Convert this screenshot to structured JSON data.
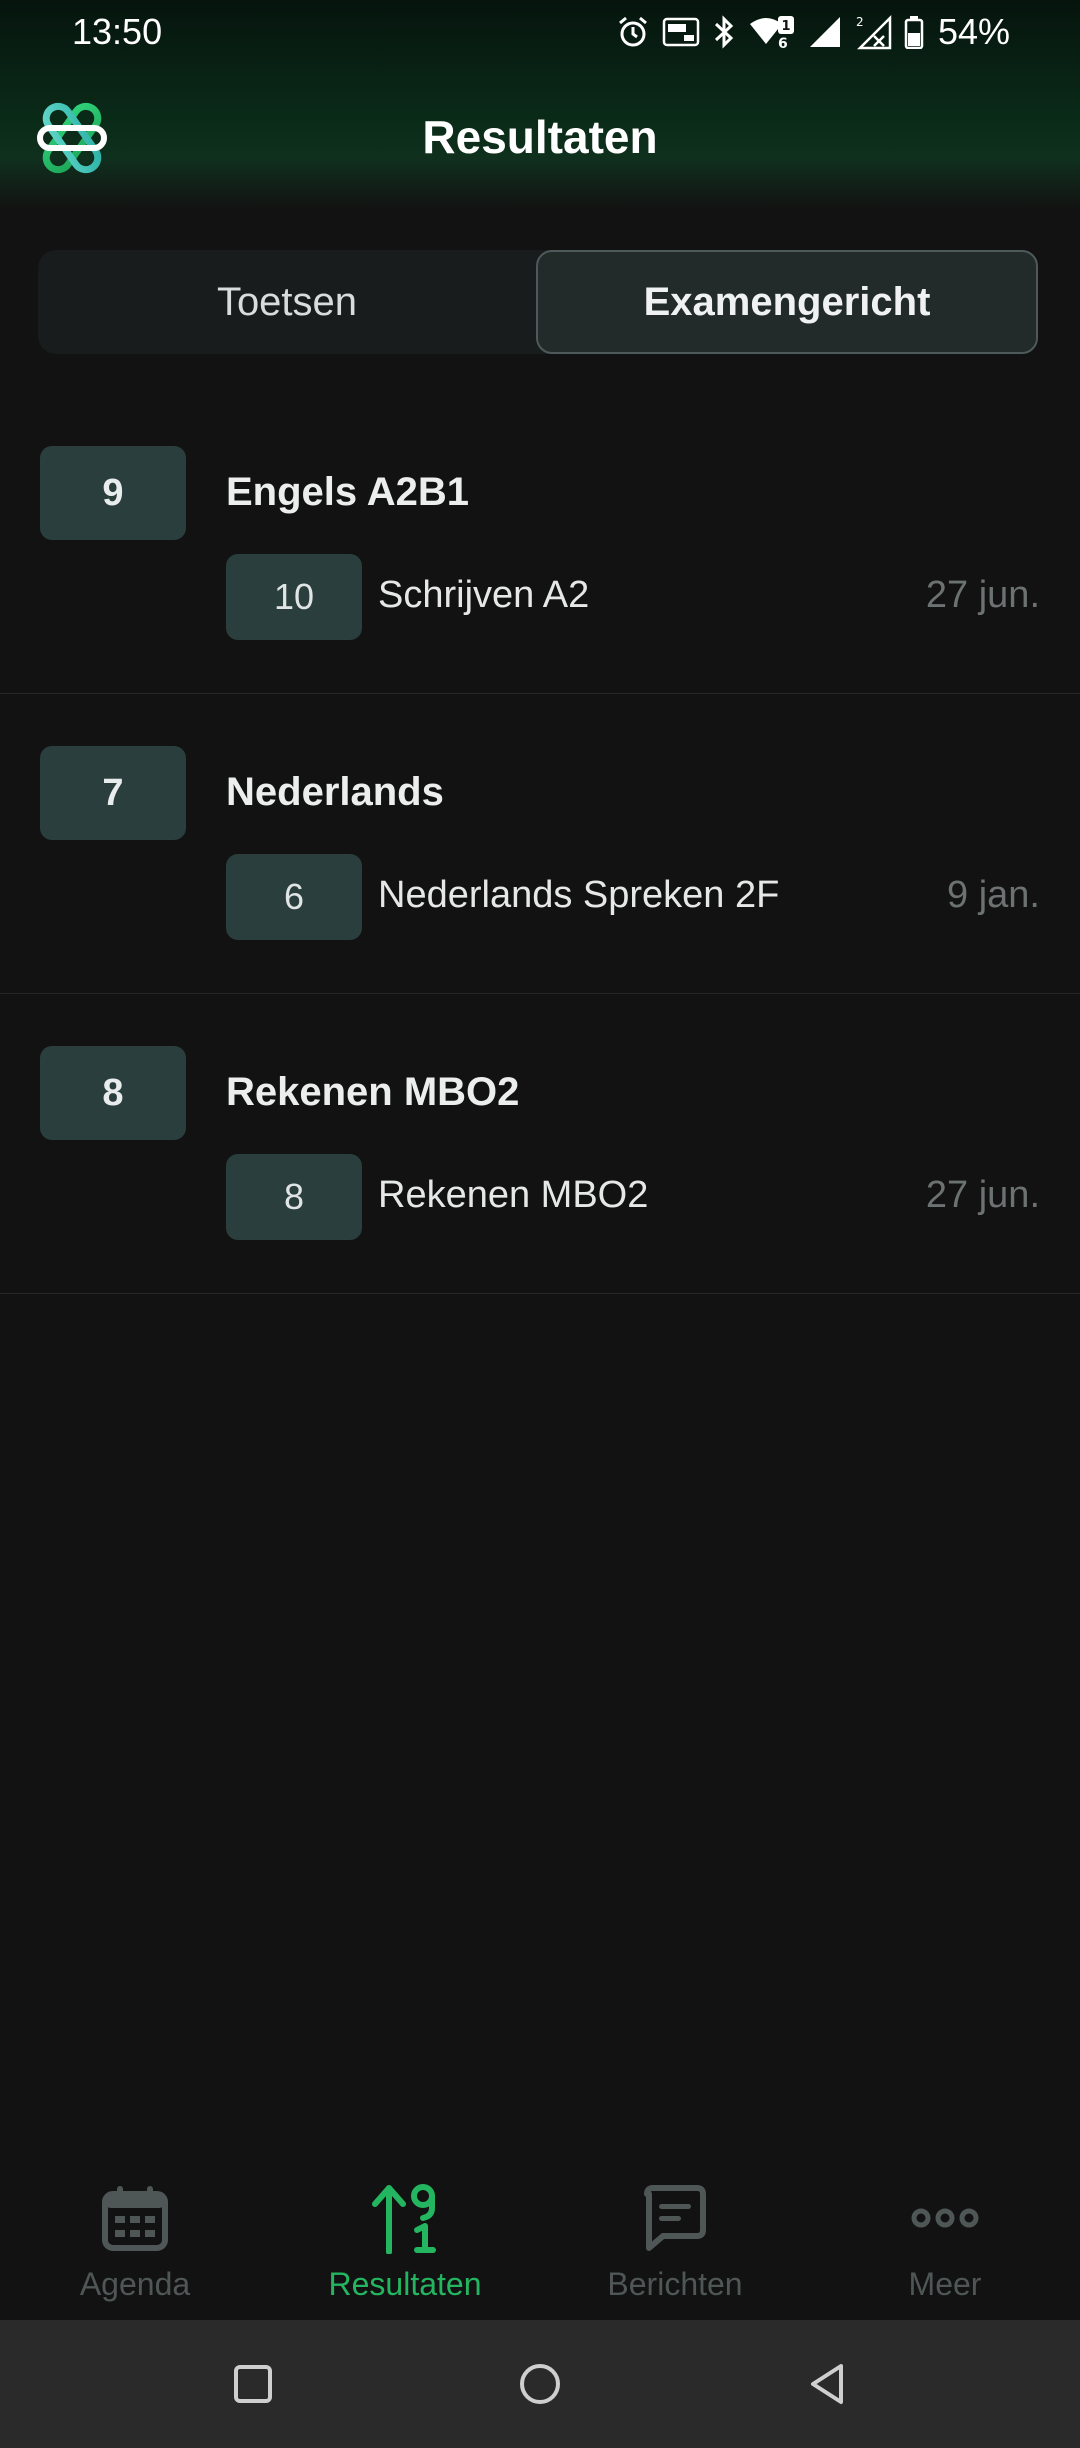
{
  "status_bar": {
    "time": "13:50",
    "battery": "54%",
    "icons": [
      "alarm-icon",
      "auto-hz-icon",
      "bluetooth-icon",
      "wifi-icon",
      "signal-icon",
      "signal-x-icon",
      "battery-icon"
    ]
  },
  "header": {
    "title": "Resultaten",
    "logo_icon": "app-logo-icon"
  },
  "tabs": {
    "toetsen": "Toetsen",
    "examengericht": "Examengericht",
    "active": "examengericht"
  },
  "results": [
    {
      "grade": "9",
      "subject": "Engels A2B1",
      "sub_grade": "10",
      "sub_name": "Schrijven A2",
      "date": "27 jun."
    },
    {
      "grade": "7",
      "subject": "Nederlands",
      "sub_grade": "6",
      "sub_name": "Nederlands Spreken 2F",
      "date": "9 jan."
    },
    {
      "grade": "8",
      "subject": "Rekenen MBO2",
      "sub_grade": "8",
      "sub_name": "Rekenen MBO2",
      "date": "27 jun."
    }
  ],
  "bottom_nav": {
    "agenda": "Agenda",
    "resultaten": "Resultaten",
    "berichten": "Berichten",
    "meer": "Meer",
    "active": "resultaten"
  },
  "colors": {
    "accent": "#24b561",
    "background": "#121212",
    "badge": "#2a3e3e"
  }
}
